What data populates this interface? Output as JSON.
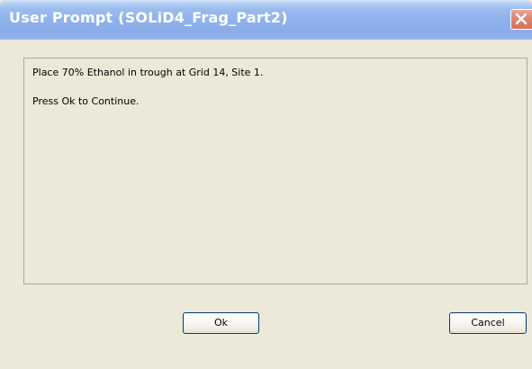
{
  "window": {
    "title": "User Prompt (SOLiD4_Frag_Part2)",
    "close_icon": "close-icon"
  },
  "message": {
    "line1": "Place 70% Ethanol in trough at Grid 14, Site 1.",
    "line2": "Press Ok to Continue."
  },
  "buttons": {
    "ok_label": "Ok",
    "cancel_label": "Cancel"
  },
  "colors": {
    "titlebar": "#8fb2ec",
    "dialog_background": "#ece9d8",
    "close_button": "#d8765e"
  }
}
